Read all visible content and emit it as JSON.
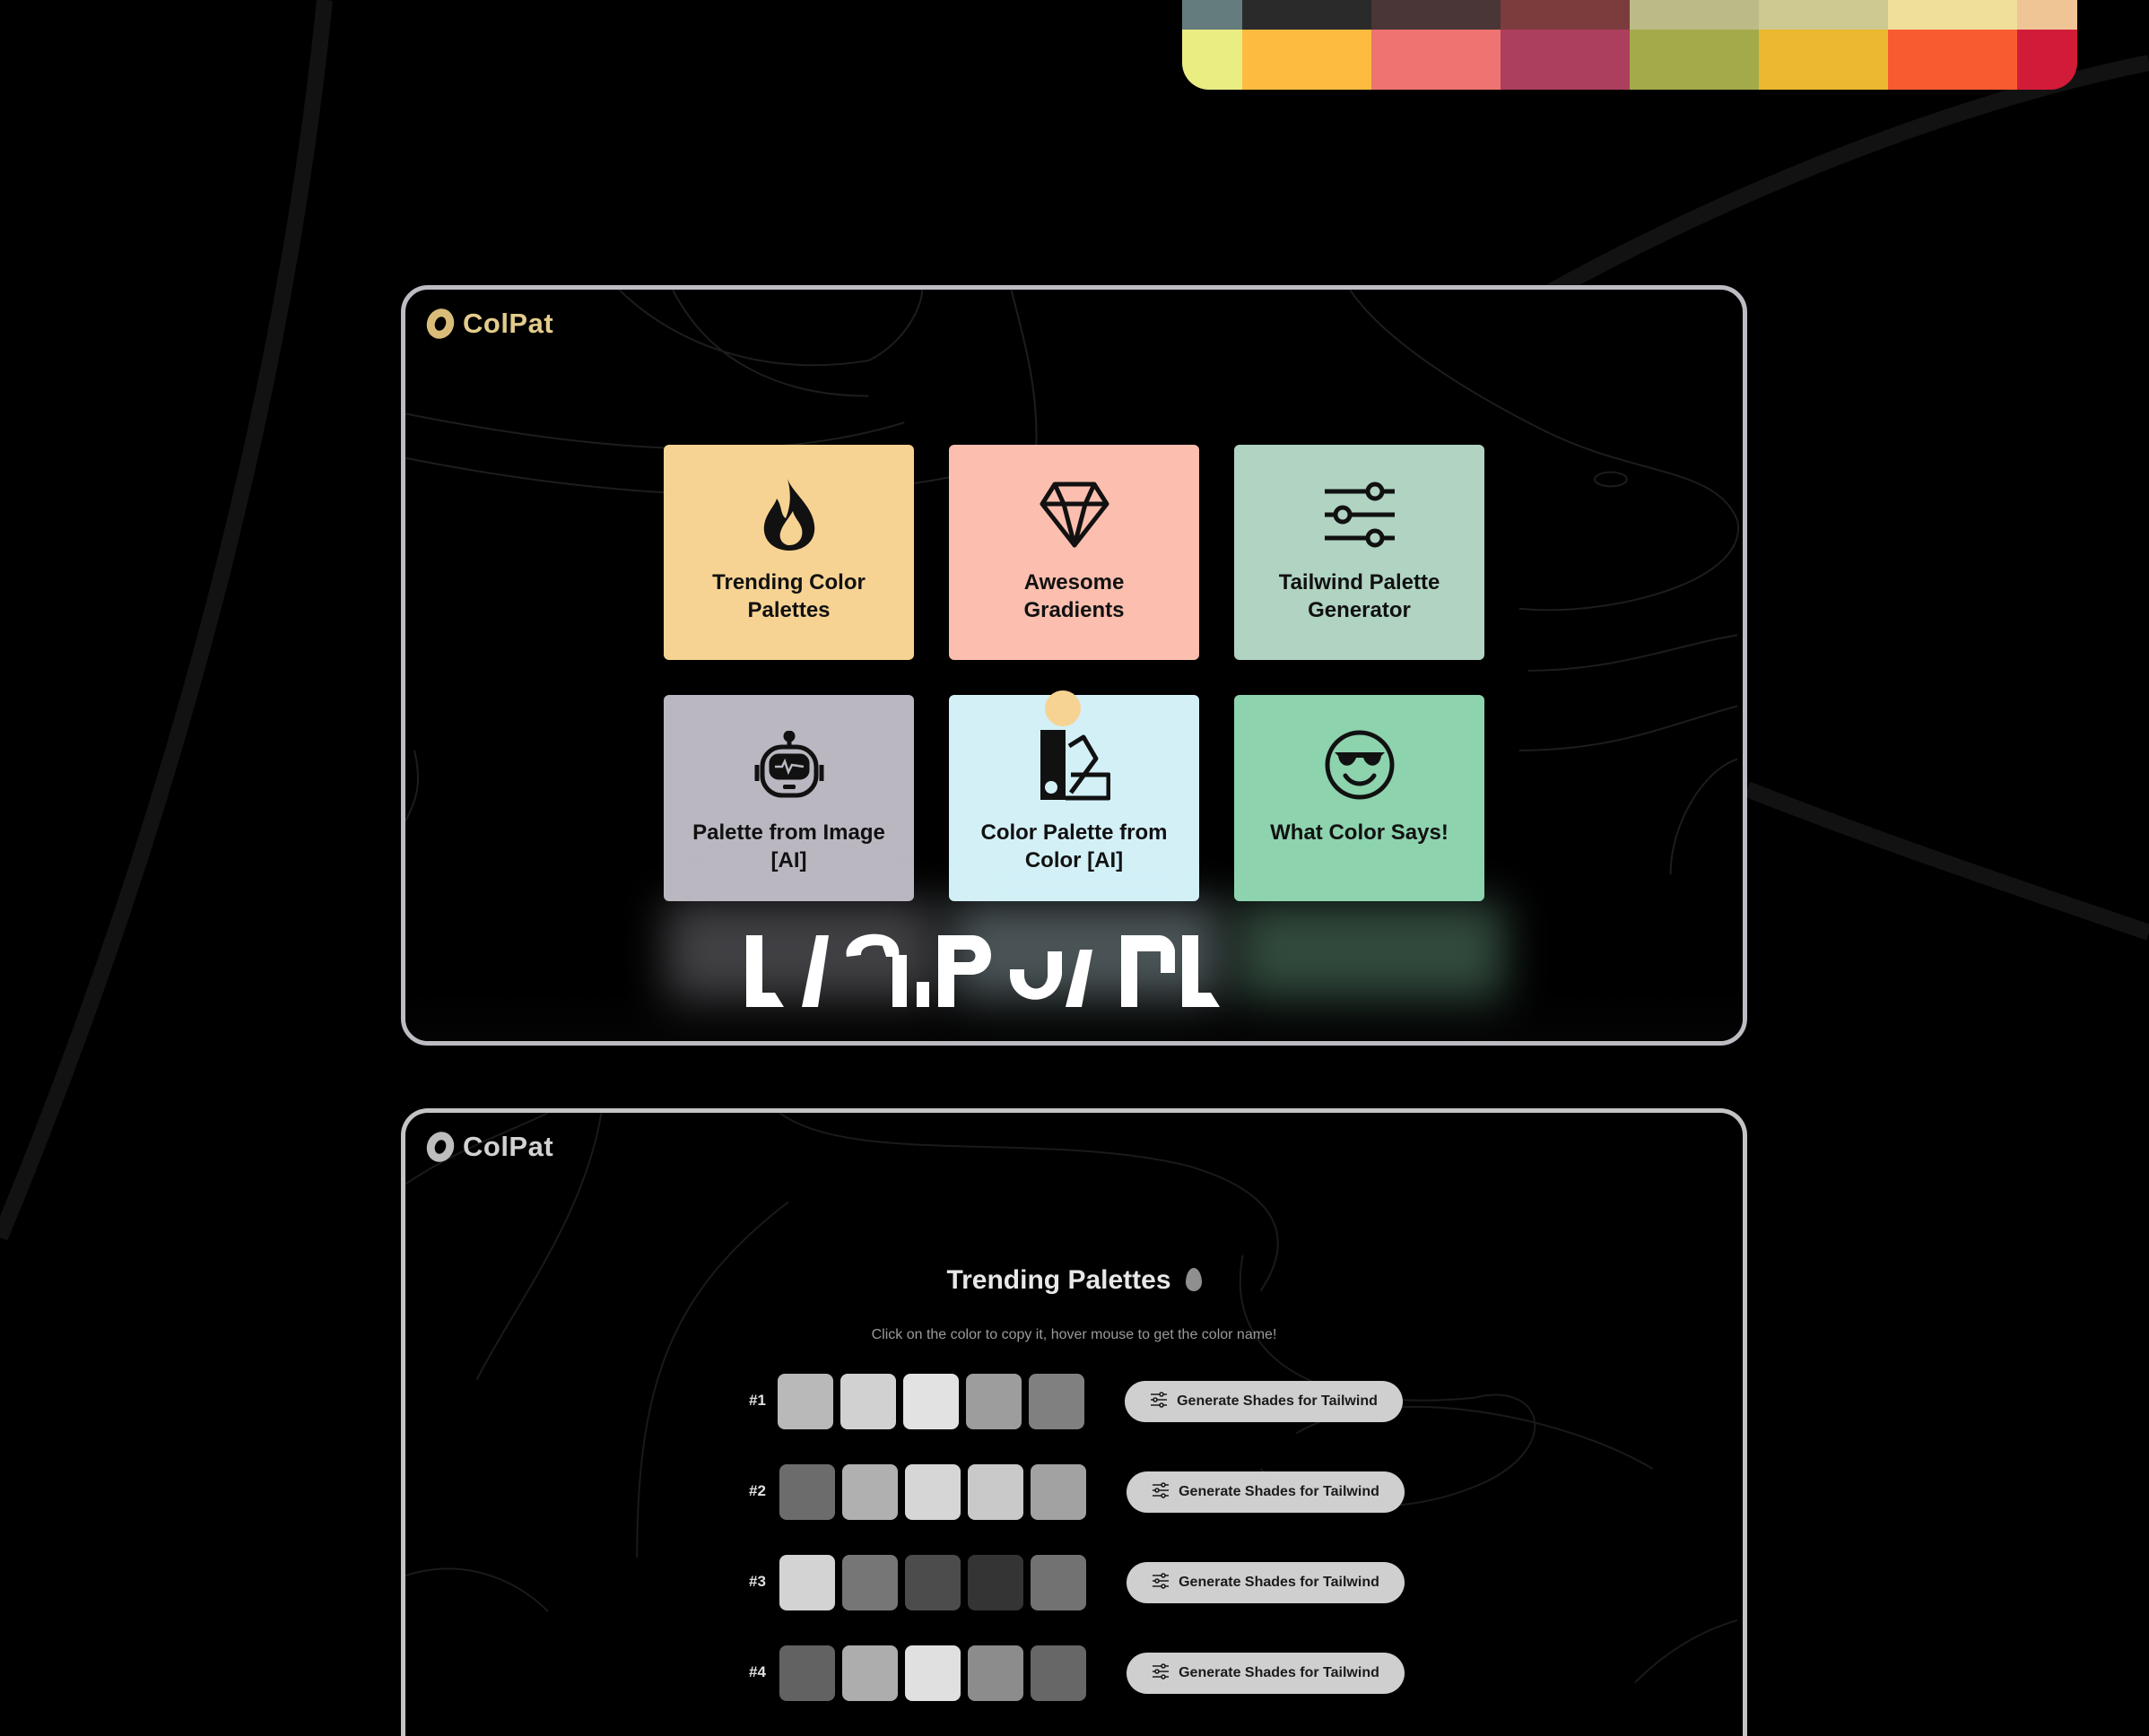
{
  "background": {
    "color": "#000000",
    "curve_color": "#121212"
  },
  "palette_strip": {
    "rows": [
      [
        "#647c7d",
        "#2a2a2a",
        "#4a3636",
        "#7c3c3e",
        "#bcbb88",
        "#cdc990",
        "#efdf9b",
        "#efc596"
      ],
      [
        "#eaed82",
        "#fdbc3f",
        "#ee7371",
        "#ac3f5e",
        "#a3aa49",
        "#ecb82f",
        "#f95b31",
        "#d21b38"
      ]
    ]
  },
  "card1": {
    "logo": {
      "icon": "donut-logo-icon",
      "text": "ColPat"
    },
    "tiles": [
      {
        "label": "Trending Color Palettes",
        "icon": "flame-icon",
        "color": "#f7d393"
      },
      {
        "label": "Awesome Gradients",
        "icon": "diamond-icon",
        "color": "#fcbeae"
      },
      {
        "label": "Tailwind Palette Generator",
        "icon": "sliders-icon",
        "color": "#b0d3c2"
      },
      {
        "label": "Palette from Image [AI]",
        "icon": "robot-icon",
        "color": "#bab7c1"
      },
      {
        "label": "Color Palette from Color [AI]",
        "icon": "swatchbook-icon",
        "color": "#d3f0f7"
      },
      {
        "label": "What Color Says!",
        "icon": "cool-smiley-icon",
        "color": "#8dd3ae"
      }
    ],
    "cursor_color": "#f7d393"
  },
  "card2": {
    "logo": {
      "icon": "donut-logo-icon",
      "text": "ColPat"
    },
    "title": "Trending Palettes",
    "title_icon": "drop-icon",
    "subtitle": "Click on the color to copy it, hover mouse to get the color name!",
    "button_label": "Generate Shades for Tailwind",
    "palettes": [
      {
        "rank": "#1",
        "colors": [
          "#b9b9b9",
          "#d1d1d1",
          "#e2e2e2",
          "#9d9d9d",
          "#808080"
        ]
      },
      {
        "rank": "#2",
        "colors": [
          "#6c6c6c",
          "#b0b0b0",
          "#d6d6d6",
          "#c9c9c9",
          "#a2a2a2"
        ]
      },
      {
        "rank": "#3",
        "colors": [
          "#d3d3d3",
          "#767676",
          "#4c4c4c",
          "#343434",
          "#727272"
        ]
      },
      {
        "rank": "#4",
        "colors": [
          "#626262",
          "#adadad",
          "#e0e0e0",
          "#8c8c8c",
          "#676767"
        ]
      }
    ]
  }
}
